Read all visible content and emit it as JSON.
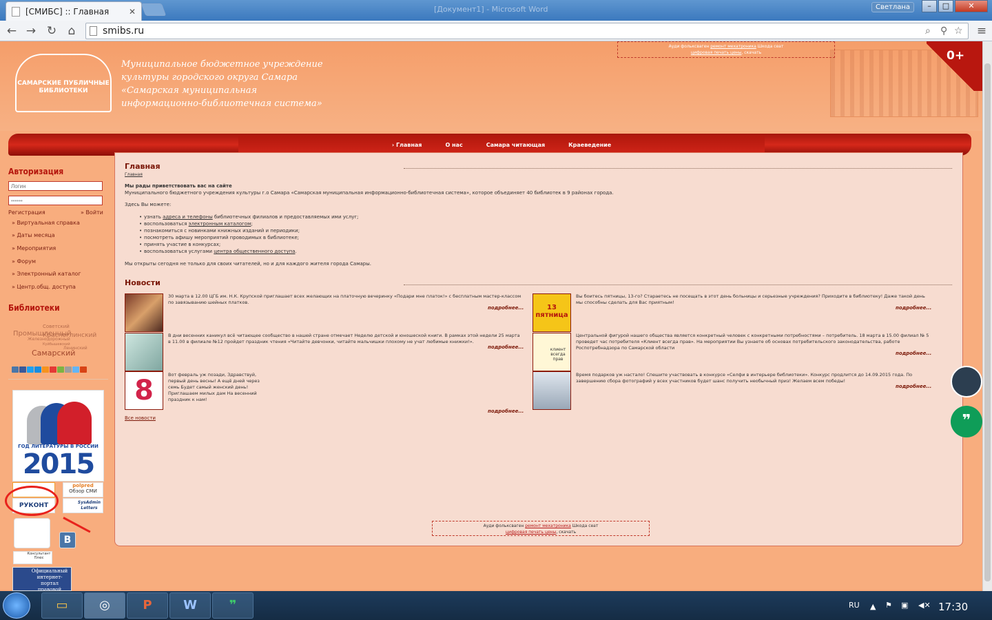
{
  "browser": {
    "tab_title": "[СМИБС] :: Главная",
    "ghost_window_title": "[Документ1] - Microsoft Word",
    "user": "Светлана",
    "url": "smibs.ru"
  },
  "header": {
    "logo_text": "САМАРСКИЕ ПУБЛИЧНЫЕ БИБЛИОТЕКИ",
    "org_name": "Муниципальное бюджетное учреждение культуры городского округа Самара «Самарская муниципальная информационно-библиотечная система»",
    "top_banner": {
      "pre": "Ауди фольксваген",
      "link1": "ремонт мехатроника",
      "mid": "Шкода сеат",
      "link2": "цифровая печать цены",
      "post": ", скачать"
    },
    "age_rating": "0+"
  },
  "nav": [
    "Главная",
    "О нас",
    "Самара читающая",
    "Краеведение"
  ],
  "sidebar": {
    "auth_title": "Авторизация",
    "login_placeholder": "Логин",
    "password_value": "••••••",
    "register": "Регистрация",
    "login_btn": "» Войти",
    "links": [
      "» Виртуальная справка",
      "» Даты месяца",
      "» Мероприятия",
      "» Форум",
      "» Электронный каталог",
      "» Центр.общ. доступа"
    ],
    "libraries_title": "Библиотеки",
    "cloud": [
      "Советский",
      "Промышленный",
      "Красноглинский",
      "Железнодорожный",
      "Куйбышевский",
      "Ленинский",
      "Самарский"
    ],
    "banner_caption": "ГОД ЛИТЕРАТУРЫ В РОССИИ",
    "banner_year": "2015",
    "partners": [
      "polpred",
      "Обзор СМИ",
      "РУКОНТ",
      "SysAdmin Letters",
      "Консультант Плюс",
      "Официальный интернет-портал правовой информации"
    ]
  },
  "main": {
    "title": "Главная",
    "breadcrumb": "Главная",
    "welcome": "Мы рады приветствовать вас на сайте",
    "intro": "Муниципального бюджетного учреждения культуры г.о Самара «Самарская муниципальная информационно-библиотечная система», которое объединяет 40 библиотек в 9 районах города.",
    "can_label": "Здесь Вы можете:",
    "items": [
      {
        "pre": "узнать ",
        "link": "адреса и телефоны",
        "post": " библиотечных филиалов и предоставляемых ими услуг;"
      },
      {
        "pre": "воспользоваться ",
        "link": "электронным каталогом",
        "post": ";"
      },
      {
        "pre": "познакомиться с новинками книжных изданий и периодики;",
        "link": "",
        "post": ""
      },
      {
        "pre": "посмотреть афишу мероприятий проводимых в библиотеке;",
        "link": "",
        "post": ""
      },
      {
        "pre": "принять участие в конкурсах;",
        "link": "",
        "post": ""
      },
      {
        "pre": "воспользоваться услугами ",
        "link": "центра общественного доступа",
        "post": "."
      }
    ],
    "outro": "Мы открыты сегодня не только для своих читателей, но и для каждого жителя города Самары.",
    "news_title": "Новости",
    "news": [
      "30 марта в 12.00 ЦГБ им. Н.К. Крупской приглашает всех желающих на платочную вечеринку «Подари мне платок!» с бесплатным мастер-классом по завязыванию шейных платков.",
      "Вы боитесь пятницы, 13-го? Стараетесь не посещать в этот день больницы и серьезные учреждения? Приходите в библиотеку! Даже такой день мы способны сделать для Вас приятным!",
      "В дни весенних каникул всё читающее сообщество в нашей стране отмечает Неделю детской и юношеской книги. В рамках этой недели 25 марта в 11.00 в филиале №12 пройдет праздник чтения «Читайте девчонки, читайте мальчишки плохому не учат любимые книжки!».",
      "Центральной фигурой нашего общества является конкретный человек с конкретными потребностями – потребитель. 18 марта в 15.00 филиал № 5 проведет час потребителя «Клиент всегда прав». На мероприятии Вы узнаете об основах потребительского законодательства, работе Роспотребнадзора по Самарской области",
      "Вот февраль уж позади, Здравствуй, первый день весны! А ещё дней через семь Будет самый женский день! Приглашаем милых дам На весенний праздник к нам!",
      "Время подарков уж настало! Спешите участвовать в конкурсе «Селфи в интерьере библиотеки». Конкурс продлится до 14.09.2015 года. По завершению сбора фотографий у всех участников будет шанс получить необычный приз! Желаем всем победы!"
    ],
    "more": "подробнее...",
    "all_news": "Все новости",
    "thumb_labels": [
      "13 пятница",
      "клиент всегда прав"
    ]
  },
  "taskbar": {
    "lang": "RU",
    "time": "17:30"
  },
  "colors": {
    "accent": "#b5160d",
    "page": "#f8ad7e",
    "panel": "#f7dcd0"
  }
}
